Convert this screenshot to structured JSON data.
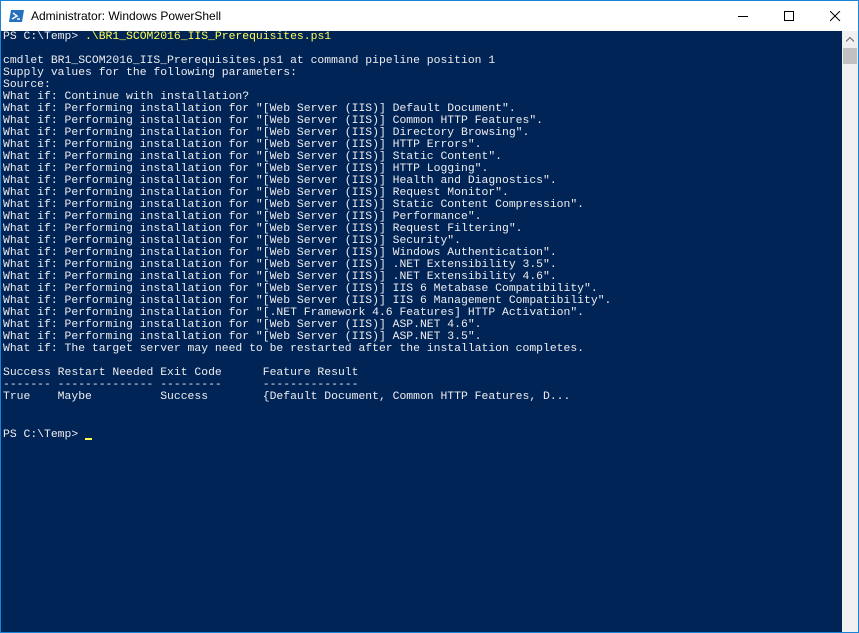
{
  "window": {
    "title": "Administrator: Windows PowerShell",
    "accent_color": "#1883d7",
    "console_background": "#012456",
    "console_foreground": "#eeedf0",
    "command_color": "#fffd55"
  },
  "title_buttons": {
    "minimize_icon": "minimize-icon",
    "maximize_icon": "maximize-icon",
    "close_icon": "close-icon"
  },
  "console": {
    "first_prompt": "PS C:\\Temp> ",
    "first_command": ".\\BR1_SCOM2016_IIS_Prerequisites.ps1",
    "output_lines": [
      "",
      "cmdlet BR1_SCOM2016_IIS_Prerequisites.ps1 at command pipeline position 1",
      "Supply values for the following parameters:",
      "Source:",
      "What if: Continue with installation?",
      "What if: Performing installation for \"[Web Server (IIS)] Default Document\".",
      "What if: Performing installation for \"[Web Server (IIS)] Common HTTP Features\".",
      "What if: Performing installation for \"[Web Server (IIS)] Directory Browsing\".",
      "What if: Performing installation for \"[Web Server (IIS)] HTTP Errors\".",
      "What if: Performing installation for \"[Web Server (IIS)] Static Content\".",
      "What if: Performing installation for \"[Web Server (IIS)] HTTP Logging\".",
      "What if: Performing installation for \"[Web Server (IIS)] Health and Diagnostics\".",
      "What if: Performing installation for \"[Web Server (IIS)] Request Monitor\".",
      "What if: Performing installation for \"[Web Server (IIS)] Static Content Compression\".",
      "What if: Performing installation for \"[Web Server (IIS)] Performance\".",
      "What if: Performing installation for \"[Web Server (IIS)] Request Filtering\".",
      "What if: Performing installation for \"[Web Server (IIS)] Security\".",
      "What if: Performing installation for \"[Web Server (IIS)] Windows Authentication\".",
      "What if: Performing installation for \"[Web Server (IIS)] .NET Extensibility 3.5\".",
      "What if: Performing installation for \"[Web Server (IIS)] .NET Extensibility 4.6\".",
      "What if: Performing installation for \"[Web Server (IIS)] IIS 6 Metabase Compatibility\".",
      "What if: Performing installation for \"[Web Server (IIS)] IIS 6 Management Compatibility\".",
      "What if: Performing installation for \"[.NET Framework 4.6 Features] HTTP Activation\".",
      "What if: Performing installation for \"[Web Server (IIS)] ASP.NET 4.6\".",
      "What if: Performing installation for \"[Web Server (IIS)] ASP.NET 3.5\".",
      "What if: The target server may need to be restarted after the installation completes.",
      "",
      "Success Restart Needed Exit Code      Feature Result",
      "------- -------------- ---------      --------------",
      "True    Maybe          Success        {Default Document, Common HTTP Features, D...",
      "",
      ""
    ],
    "last_prompt": "PS C:\\Temp> "
  },
  "table": {
    "headers": [
      "Success",
      "Restart Needed",
      "Exit Code",
      "Feature Result"
    ],
    "rows": [
      [
        "True",
        "Maybe",
        "Success",
        "{Default Document, Common HTTP Features, D..."
      ]
    ]
  }
}
